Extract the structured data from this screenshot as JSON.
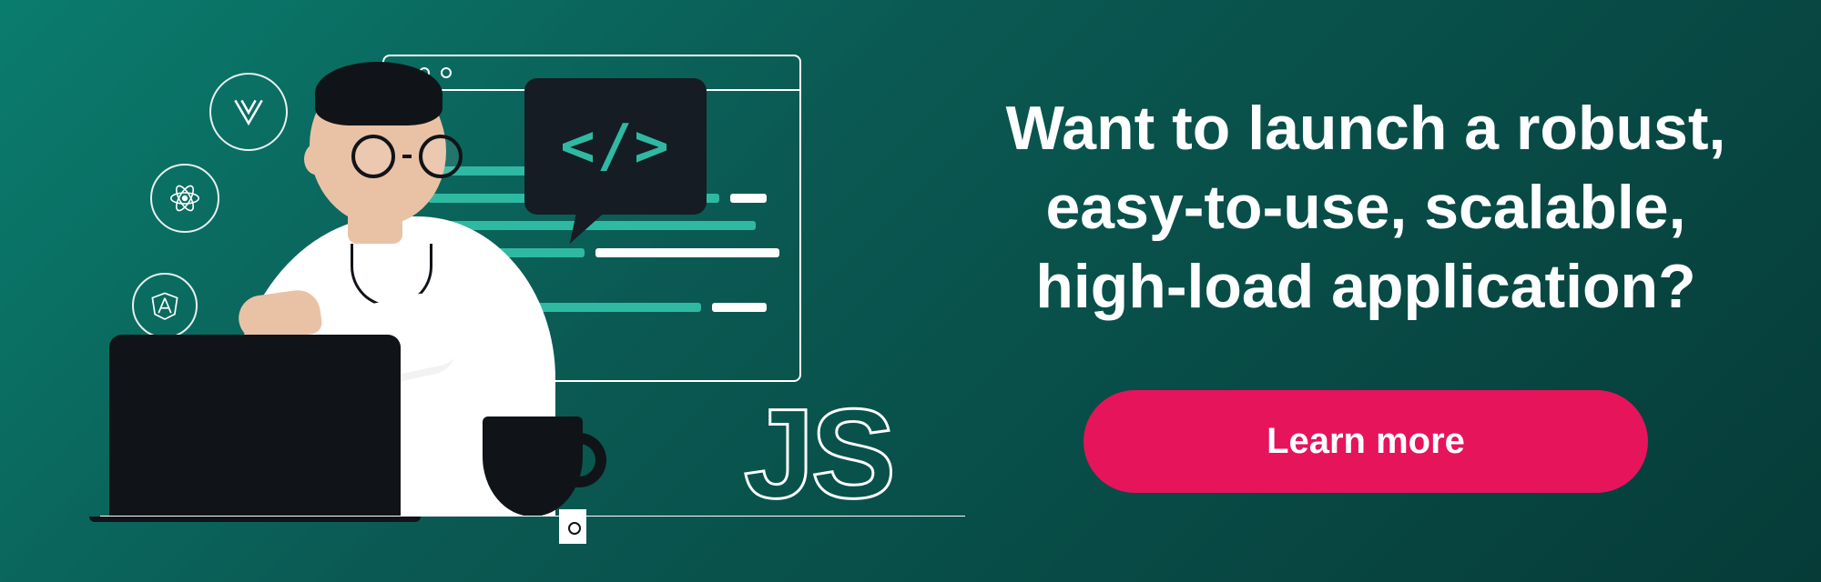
{
  "headline": "Want to launch a robust, easy-to-use, scalable, high-load application?",
  "cta_label": "Learn more",
  "speech_code": "</>",
  "js_label": "JS",
  "colors": {
    "accent": "#e6145a",
    "teal": "#2fb9a3",
    "dark": "#151c23"
  }
}
